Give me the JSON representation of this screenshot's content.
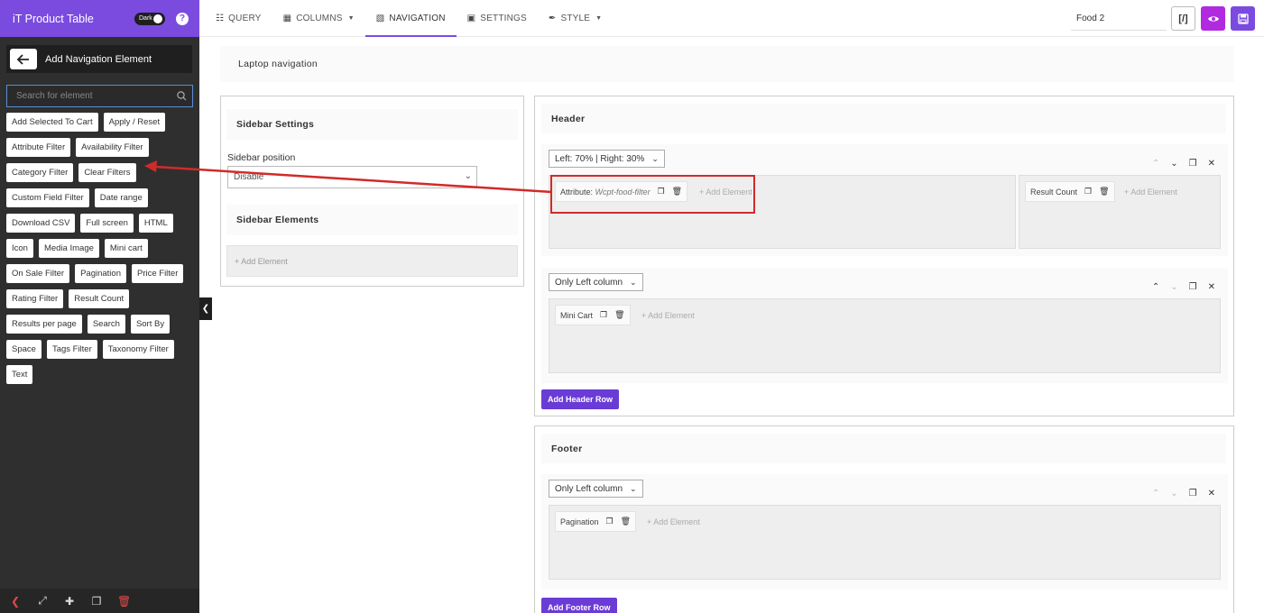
{
  "app": {
    "title": "iT Product Table",
    "dark_label": "Dark",
    "help": "?"
  },
  "sidebar": {
    "back_title": "Add Navigation Element",
    "search_placeholder": "Search for element",
    "elements": [
      "Add Selected To Cart",
      "Apply / Reset",
      "Attribute Filter",
      "Availability Filter",
      "Category Filter",
      "Clear Filters",
      "Custom Field Filter",
      "Date range",
      "Download CSV",
      "Full screen",
      "HTML",
      "Icon",
      "Media Image",
      "Mini cart",
      "On Sale Filter",
      "Pagination",
      "Price Filter",
      "Rating Filter",
      "Result Count",
      "Results per page",
      "Search",
      "Sort By",
      "Space",
      "Tags Filter",
      "Taxonomy Filter",
      "Text"
    ]
  },
  "nav": {
    "tabs": [
      {
        "label": "QUERY",
        "icon": "database-icon"
      },
      {
        "label": "COLUMNS",
        "icon": "table-icon"
      },
      {
        "label": "NAVIGATION",
        "icon": "navigation-icon"
      },
      {
        "label": "SETTINGS",
        "icon": "settings-icon"
      },
      {
        "label": "STYLE",
        "icon": "brush-icon"
      }
    ],
    "active": "NAVIGATION",
    "table_name": "Food 2",
    "code_label": "[/]"
  },
  "main": {
    "section_title": "Laptop navigation",
    "sidebar_settings": {
      "title": "Sidebar Settings",
      "position_label": "Sidebar position",
      "position_value": "Disable",
      "elements_title": "Sidebar Elements",
      "add_element": "+ Add Element"
    },
    "header": {
      "title": "Header",
      "rows": [
        {
          "layout": "Left: 70% | Right: 30%",
          "left": {
            "element_label": "Attribute:",
            "element_value": "Wcpt-food-filter",
            "add": "+ Add Element"
          },
          "right": {
            "element_label": "Result Count",
            "add": "+ Add Element"
          }
        },
        {
          "layout": "Only Left column",
          "left": {
            "element_label": "Mini Cart",
            "add": "+ Add Element"
          }
        }
      ],
      "add_row": "Add Header Row"
    },
    "footer": {
      "title": "Footer",
      "rows": [
        {
          "layout": "Only Left column",
          "left": {
            "element_label": "Pagination",
            "add": "+ Add Element"
          }
        }
      ],
      "add_row": "Add Footer Row"
    }
  },
  "colors": {
    "brand": "#7b4be0",
    "preview": "#b12ae0",
    "annotation": "#d12a2a"
  }
}
